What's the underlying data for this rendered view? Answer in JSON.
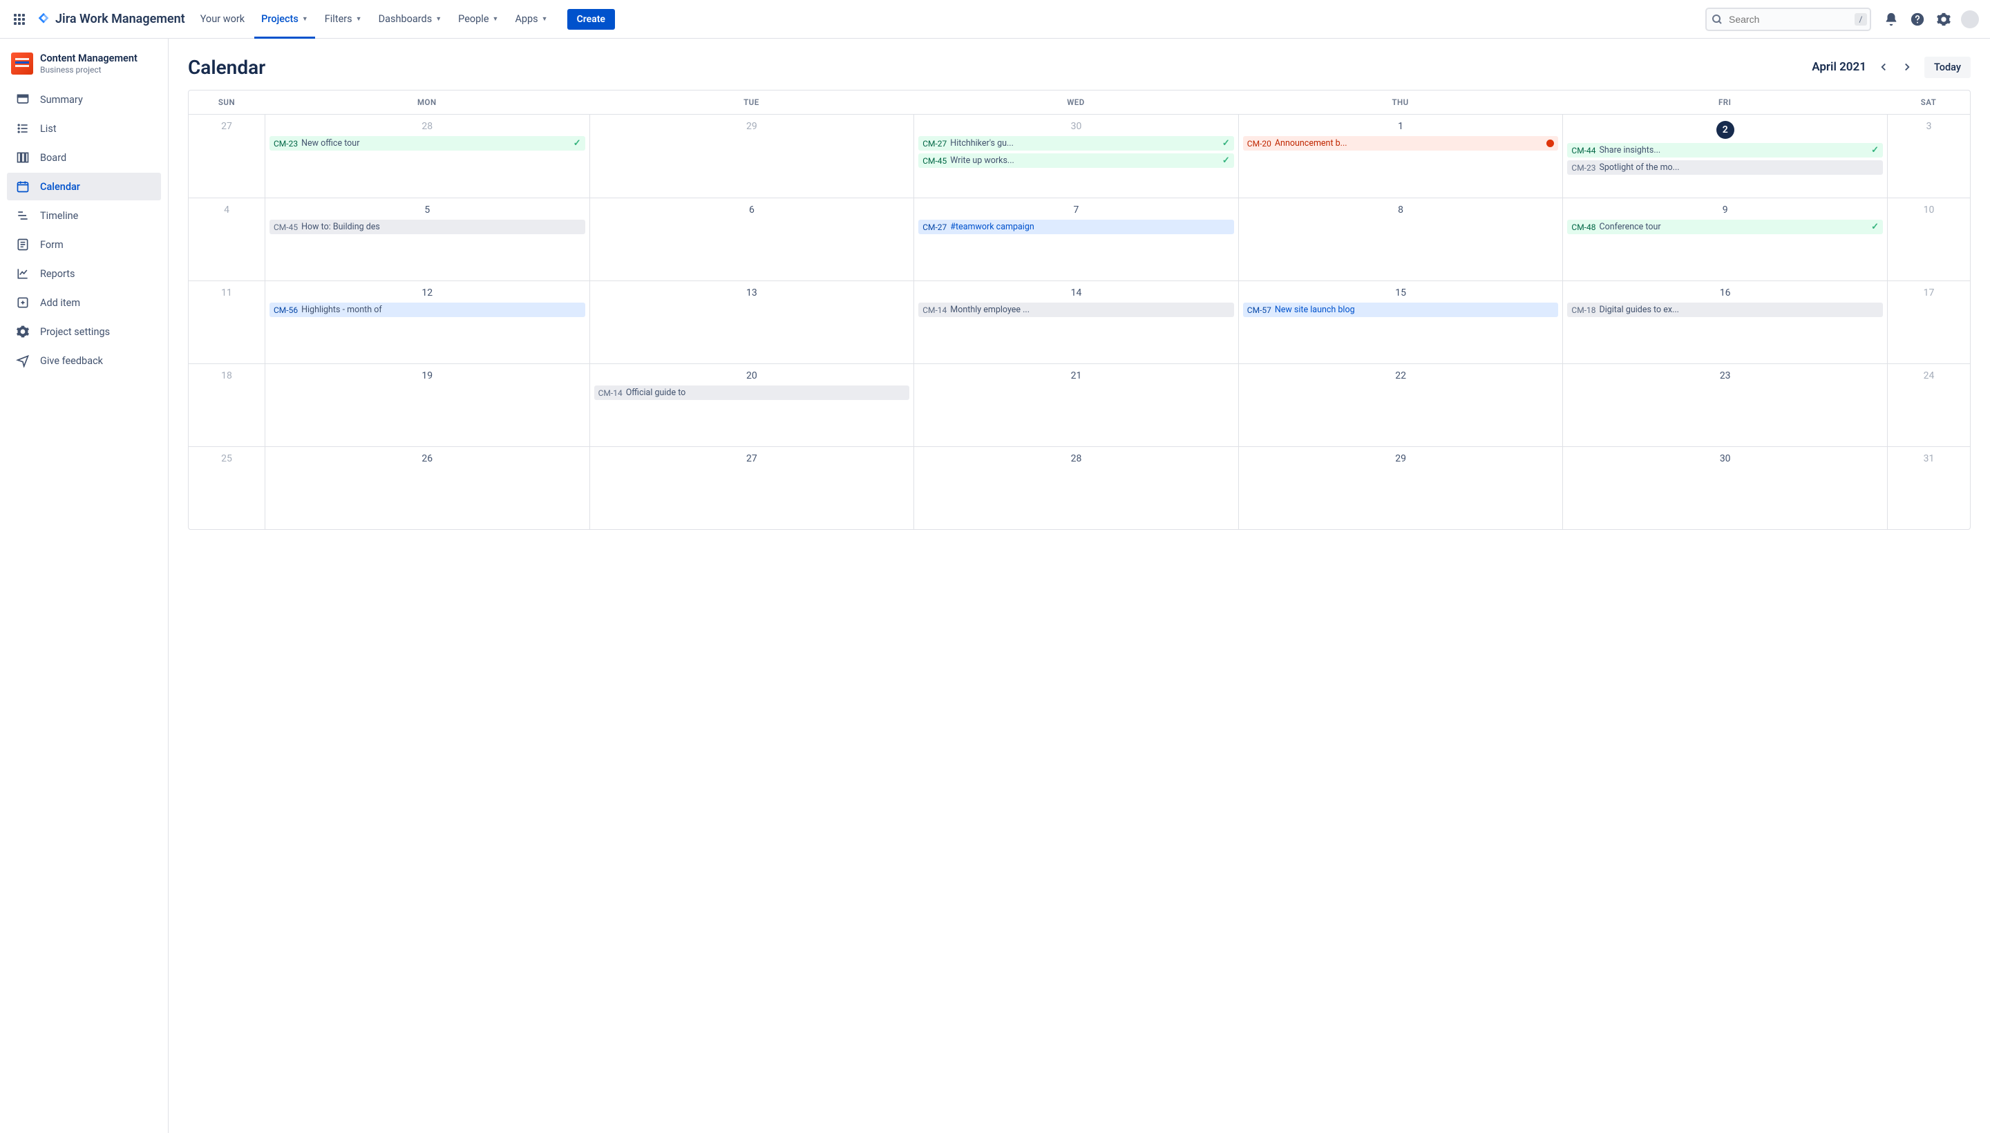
{
  "app_name": "Jira Work Management",
  "nav": {
    "your_work": "Your work",
    "projects": "Projects",
    "filters": "Filters",
    "dashboards": "Dashboards",
    "people": "People",
    "apps": "Apps",
    "create": "Create"
  },
  "search": {
    "placeholder": "Search",
    "key": "/"
  },
  "project": {
    "name": "Content Management",
    "type": "Business project"
  },
  "sidebar": {
    "items": [
      {
        "label": "Summary"
      },
      {
        "label": "List"
      },
      {
        "label": "Board"
      },
      {
        "label": "Calendar"
      },
      {
        "label": "Timeline"
      },
      {
        "label": "Form"
      },
      {
        "label": "Reports"
      },
      {
        "label": "Add item"
      },
      {
        "label": "Project settings"
      },
      {
        "label": "Give feedback"
      }
    ]
  },
  "calendar": {
    "title": "Calendar",
    "month": "April 2021",
    "today_label": "Today",
    "day_headers": [
      "SUN",
      "MON",
      "TUE",
      "WED",
      "THU",
      "FRI",
      "SAT"
    ],
    "grid": [
      [
        {
          "n": "27",
          "mute": true
        },
        {
          "n": "28",
          "mute": true,
          "events": [
            {
              "key": "CM-23",
              "title": "New office tour",
              "color": "green",
              "check": true
            }
          ]
        },
        {
          "n": "29",
          "mute": true
        },
        {
          "n": "30",
          "mute": true,
          "events": [
            {
              "key": "CM-27",
              "title": "Hitchhiker's gu...",
              "color": "green",
              "check": true
            },
            {
              "key": "CM-45",
              "title": "Write up works...",
              "color": "green",
              "check": true
            }
          ]
        },
        {
          "n": "1",
          "events": [
            {
              "key": "CM-20",
              "title": "Announcement b...",
              "color": "red",
              "err": true
            }
          ]
        },
        {
          "n": "2",
          "today": true,
          "events": [
            {
              "key": "CM-44",
              "title": "Share insights...",
              "color": "green",
              "check": true
            },
            {
              "key": "CM-23",
              "title": "Spotlight of the mo...",
              "color": "gray"
            }
          ]
        },
        {
          "n": "3",
          "mute": true
        }
      ],
      [
        {
          "n": "4",
          "mute": true
        },
        {
          "n": "5",
          "events": [
            {
              "key": "CM-45",
              "title": "How to: Building des",
              "color": "gray"
            }
          ]
        },
        {
          "n": "6"
        },
        {
          "n": "7",
          "events": [
            {
              "key": "CM-27",
              "title": "#teamwork campaign",
              "color": "blue"
            }
          ]
        },
        {
          "n": "8"
        },
        {
          "n": "9",
          "events": [
            {
              "key": "CM-48",
              "title": "Conference tour",
              "color": "green",
              "check": true
            }
          ]
        },
        {
          "n": "10",
          "mute": true
        }
      ],
      [
        {
          "n": "11",
          "mute": true
        },
        {
          "n": "12",
          "events": [
            {
              "key": "CM-56",
              "title": "Highlights - month of",
              "color": "lblue"
            }
          ]
        },
        {
          "n": "13"
        },
        {
          "n": "14",
          "events": [
            {
              "key": "CM-14",
              "title": "Monthly employee ...",
              "color": "gray"
            }
          ]
        },
        {
          "n": "15",
          "events": [
            {
              "key": "CM-57",
              "title": "New site launch blog",
              "color": "blue"
            }
          ]
        },
        {
          "n": "16",
          "events": [
            {
              "key": "CM-18",
              "title": "Digital guides to ex...",
              "color": "gray"
            }
          ]
        },
        {
          "n": "17",
          "mute": true
        }
      ],
      [
        {
          "n": "18",
          "mute": true
        },
        {
          "n": "19"
        },
        {
          "n": "20",
          "events": [
            {
              "key": "CM-14",
              "title": "Official guide to",
              "color": "gray"
            }
          ]
        },
        {
          "n": "21"
        },
        {
          "n": "22"
        },
        {
          "n": "23"
        },
        {
          "n": "24",
          "mute": true
        }
      ],
      [
        {
          "n": "25",
          "mute": true
        },
        {
          "n": "26"
        },
        {
          "n": "27"
        },
        {
          "n": "28"
        },
        {
          "n": "29"
        },
        {
          "n": "30"
        },
        {
          "n": "31",
          "mute": true
        }
      ]
    ]
  }
}
